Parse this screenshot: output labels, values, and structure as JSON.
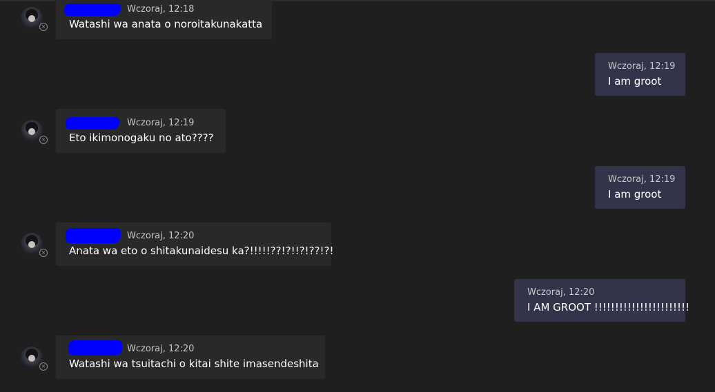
{
  "messages": [
    {
      "direction": "incoming",
      "sender_redacted": true,
      "timestamp": "Wczoraj, 12:18",
      "text": "Watashi wa anata o noroitakunakatta",
      "avatar_icon": "user-avatar-icon",
      "status_icon": "status-offline-icon"
    },
    {
      "direction": "outgoing",
      "timestamp": "Wczoraj, 12:19",
      "text": "I am groot"
    },
    {
      "direction": "incoming",
      "sender_redacted": true,
      "timestamp": "Wczoraj, 12:19",
      "text": "Eto ikimonogaku no ato????",
      "avatar_icon": "user-avatar-icon",
      "status_icon": "status-offline-icon"
    },
    {
      "direction": "outgoing",
      "timestamp": "Wczoraj, 12:19",
      "text": "I am groot"
    },
    {
      "direction": "incoming",
      "sender_redacted": true,
      "timestamp": "Wczoraj, 12:20",
      "text": "Anata wa eto o shitakunaidesu ka?!!!!!??!?!!?!??!?!",
      "avatar_icon": "user-avatar-icon",
      "status_icon": "status-offline-icon"
    },
    {
      "direction": "outgoing",
      "timestamp": "Wczoraj, 12:20",
      "text": "I AM GROOT !!!!!!!!!!!!!!!!!!!!!!!"
    },
    {
      "direction": "incoming",
      "sender_redacted": true,
      "timestamp": "Wczoraj, 12:20",
      "text": "Watashi wa tsuitachi o kitai shite imasendeshita",
      "avatar_icon": "user-avatar-icon",
      "status_icon": "status-offline-icon"
    }
  ],
  "colors": {
    "background": "#1f1f1f",
    "incoming_bubble": "#292929",
    "outgoing_bubble": "#33344a",
    "redaction": "#0000ff",
    "text": "#ffffff",
    "meta_text": "#c8c8c8"
  }
}
